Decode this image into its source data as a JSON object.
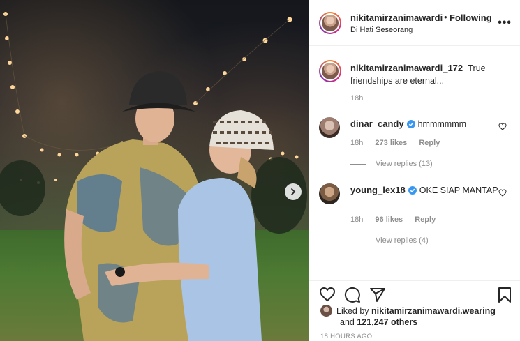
{
  "post": {
    "header": {
      "username": "nikitamirzanimawardi_",
      "separator": "•",
      "follow_status": "Following",
      "location": "Di Hati Seseorang"
    },
    "caption": {
      "username": "nikitamirzanimawardi_172",
      "text": "True friendships are eternal...",
      "time": "18h"
    },
    "comments": [
      {
        "username": "dinar_candy",
        "verified": true,
        "text": "hmmmmmm",
        "time": "18h",
        "likes": "273 likes",
        "reply_label": "Reply",
        "view_replies": "View replies (13)"
      },
      {
        "username": "young_lex18",
        "verified": true,
        "text": "OKE SIAP MANTAP",
        "time": "18h",
        "likes": "96 likes",
        "reply_label": "Reply",
        "view_replies": "View replies (4)"
      }
    ],
    "likes": {
      "prefix": "Liked by",
      "user": "nikitamirzanimawardi.wearing",
      "and": "and",
      "others": "121,247 others"
    },
    "timestamp": "18 HOURS AGO"
  },
  "icons": {
    "more": "more-options-icon",
    "like": "heart-icon",
    "comment": "comment-icon",
    "share": "share-icon",
    "save": "bookmark-icon",
    "next": "chevron-right-icon",
    "verified": "verified-badge-icon"
  },
  "colors": {
    "verified": "#3897f0",
    "text": "#262626",
    "muted": "#8e8e8e"
  }
}
